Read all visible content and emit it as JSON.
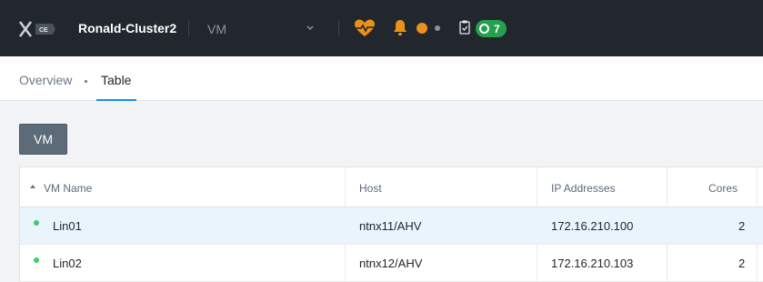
{
  "header": {
    "logo_icon": "nutanix-x-logo",
    "logo_badge": "CE",
    "cluster_name": "Ronald-Cluster2",
    "entity_selector": "VM",
    "chevron_icon": "chevron-down-icon",
    "health_icon": "heart-pulse-icon",
    "alerts_icon": "bell-icon",
    "tasks_icon": "clipboard-check-icon",
    "tasks_count": "7",
    "colors": {
      "bar": "#21272d",
      "health": "#e8911d",
      "tasks": "#23a04e"
    }
  },
  "subnav": {
    "tabs": [
      {
        "label": "Overview",
        "active": false
      },
      {
        "label": "Table",
        "active": true
      }
    ]
  },
  "toolbar": {
    "vm_button": "VM"
  },
  "table": {
    "columns": [
      "VM Name",
      "Host",
      "IP Addresses",
      "Cores"
    ],
    "sort": {
      "column": "VM Name",
      "direction": "ascending"
    },
    "rows": [
      {
        "name": "Lin01",
        "host": "ntnx11/AHV",
        "ip": "172.16.210.100",
        "cores": "2",
        "status": "on",
        "selected": true
      },
      {
        "name": "Lin02",
        "host": "ntnx12/AHV",
        "ip": "172.16.210.103",
        "cores": "2",
        "status": "on",
        "selected": false
      }
    ]
  }
}
